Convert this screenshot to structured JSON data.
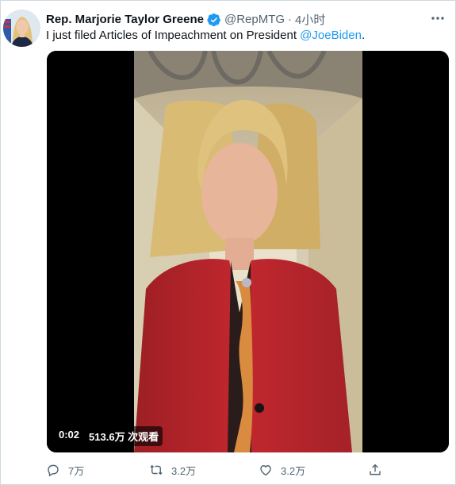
{
  "tweet": {
    "author_name": "Rep. Marjorie Taylor Greene",
    "handle": "@RepMTG",
    "separator": "·",
    "time": "4小时",
    "text_before": "I just filed Articles of Impeachment on President ",
    "mention": "@JoeBiden",
    "text_after": "."
  },
  "video": {
    "elapsed": "0:02",
    "views": "513.6万 次观看"
  },
  "actions": {
    "replies": "7万",
    "retweets": "3.2万",
    "likes": "3.2万"
  },
  "icons": {
    "verified": "verified-badge-icon",
    "more": "more-icon",
    "reply": "reply-icon",
    "retweet": "retweet-icon",
    "like": "heart-icon",
    "share": "share-icon"
  },
  "colors": {
    "accent": "#1d9bf0",
    "secondary_text": "#536471",
    "border": "#cfd9de"
  }
}
